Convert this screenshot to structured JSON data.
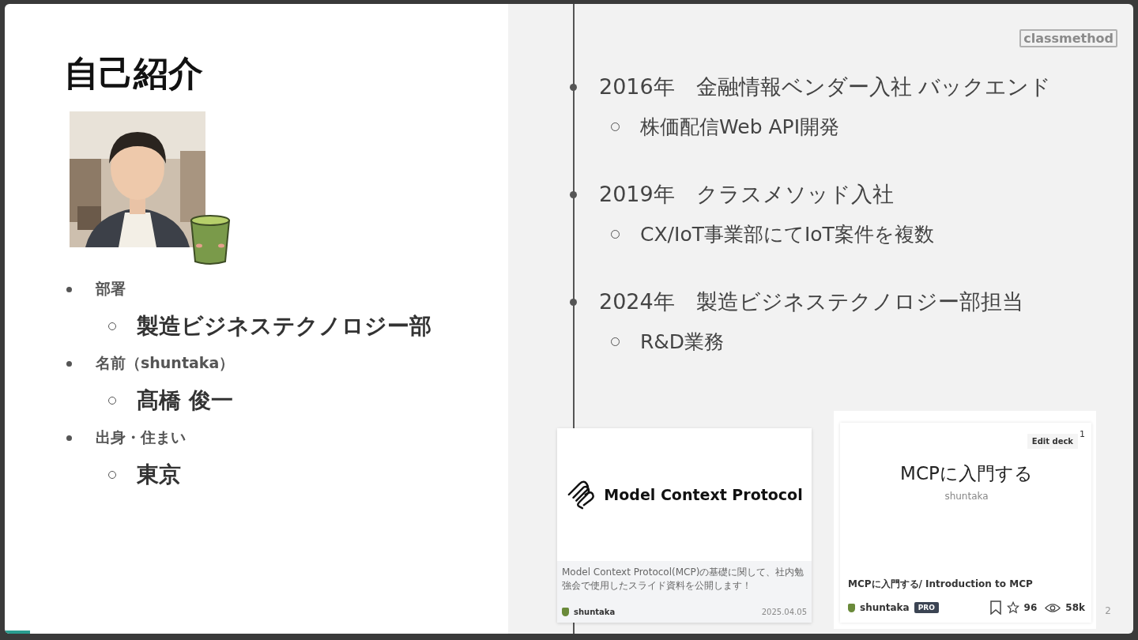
{
  "title": "自己紹介",
  "profile": [
    {
      "label": "部署",
      "value": "製造ビジネステクノロジー部"
    },
    {
      "label": "名前（shuntaka）",
      "value": "髙橋 俊一"
    },
    {
      "label": "出身・住まい",
      "value": "東京"
    }
  ],
  "timeline": [
    {
      "heading": "2016年　金融情報ベンダー入社 バックエンド",
      "detail": "株価配信Web API開発"
    },
    {
      "heading": "2019年　クラスメソッド入社",
      "detail": "CX/IoT事業部にてIoT案件を複数"
    },
    {
      "heading": "2024年　製造ビジネステクノロジー部担当",
      "detail": "R&D業務"
    }
  ],
  "logo": "classmethod",
  "cards": [
    {
      "kind": "article",
      "cover_title": "Model Context Protocol",
      "description": "Model Context Protocol(MCP)の基礎に関して、社内勉強会で使用したスライド資料を公開します！",
      "author": "shuntaka",
      "date": "2025.04.05"
    },
    {
      "kind": "deck",
      "edit_button": "Edit deck",
      "badge": "1",
      "cover_title": "MCPに入門する",
      "cover_subtitle": "shuntaka",
      "title": "MCPに入門する/ Introduction to MCP",
      "author": "shuntaka",
      "plan": "PRO",
      "stars": "96",
      "views": "58k"
    }
  ],
  "page_number": "2"
}
